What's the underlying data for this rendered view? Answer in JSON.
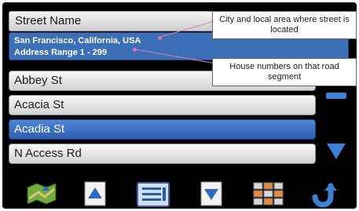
{
  "header": {
    "title": "Street Name"
  },
  "info": {
    "city": "San Francisco, California, USA",
    "address_range": "Address Range 1 - 299"
  },
  "streets": [
    {
      "label": "Abbey St",
      "selected": false
    },
    {
      "label": "Acacia St",
      "selected": false
    },
    {
      "label": "Acadia St",
      "selected": true
    },
    {
      "label": "N Access Rd",
      "selected": false
    }
  ],
  "callouts": {
    "city": "City and local area where street is located",
    "house_numbers": "House numbers on that road segment"
  },
  "toolbar": {
    "icons": [
      "map-icon",
      "page-up-icon",
      "list-icon",
      "page-down-icon",
      "keypad-icon",
      "back-icon"
    ]
  },
  "colors": {
    "selected_row": "#2a5fb4",
    "info_bar": "#3b6fb8",
    "accent_arrow": "#3b82d6"
  }
}
